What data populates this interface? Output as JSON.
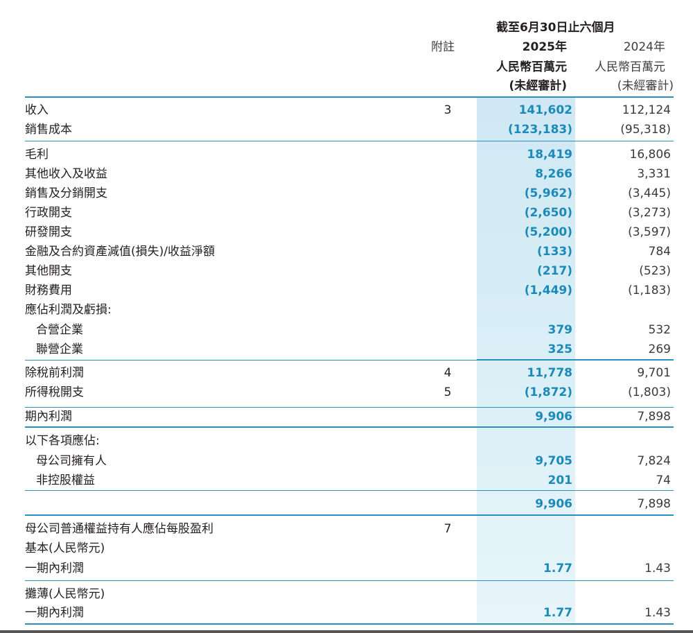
{
  "header": {
    "period": "截至6月30日止六個月",
    "note_label": "附註",
    "year_2025": "2025年",
    "year_2024": "2024年",
    "unit_2025": "人民幣百萬元",
    "unit_2024": "人民幣百萬元",
    "audit_2025": "(未經審計)",
    "audit_2024": "(未經審計)"
  },
  "rows": [
    {
      "label": "收入",
      "note": "3",
      "v2025": "141,602",
      "v2024": "112,124"
    },
    {
      "label": "銷售成本",
      "note": "",
      "v2025": "(123,183)",
      "v2024": "(95,318)"
    },
    {
      "label": "毛利",
      "note": "",
      "v2025": "18,419",
      "v2024": "16,806"
    },
    {
      "label": "其他收入及收益",
      "note": "",
      "v2025": "8,266",
      "v2024": "3,331"
    },
    {
      "label": "銷售及分銷開支",
      "note": "",
      "v2025": "(5,962)",
      "v2024": "(3,445)"
    },
    {
      "label": "行政開支",
      "note": "",
      "v2025": "(2,650)",
      "v2024": "(3,273)"
    },
    {
      "label": "研發開支",
      "note": "",
      "v2025": "(5,200)",
      "v2024": "(3,597)"
    },
    {
      "label": "金融及合約資產減值(損失)/收益淨額",
      "note": "",
      "v2025": "(133)",
      "v2024": "784"
    },
    {
      "label": "其他開支",
      "note": "",
      "v2025": "(217)",
      "v2024": "(523)"
    },
    {
      "label": "財務費用",
      "note": "",
      "v2025": "(1,449)",
      "v2024": "(1,183)"
    },
    {
      "label": "應佔利潤及虧損:",
      "note": "",
      "v2025": "",
      "v2024": ""
    },
    {
      "label": "合營企業",
      "note": "",
      "v2025": "379",
      "v2024": "532"
    },
    {
      "label": "聯營企業",
      "note": "",
      "v2025": "325",
      "v2024": "269"
    },
    {
      "label": "除稅前利潤",
      "note": "4",
      "v2025": "11,778",
      "v2024": "9,701"
    },
    {
      "label": "所得稅開支",
      "note": "5",
      "v2025": "(1,872)",
      "v2024": "(1,803)"
    },
    {
      "label": "期內利潤",
      "note": "",
      "v2025": "9,906",
      "v2024": "7,898"
    },
    {
      "label": "以下各項應佔:",
      "note": "",
      "v2025": "",
      "v2024": ""
    },
    {
      "label": "母公司擁有人",
      "note": "",
      "v2025": "9,705",
      "v2024": "7,824"
    },
    {
      "label": "非控股權益",
      "note": "",
      "v2025": "201",
      "v2024": "74"
    },
    {
      "label": "",
      "note": "",
      "v2025": "9,906",
      "v2024": "7,898"
    },
    {
      "label": "母公司普通權益持有人應佔每股盈利",
      "note": "7",
      "v2025": "",
      "v2024": ""
    },
    {
      "label": "基本(人民幣元)",
      "note": "",
      "v2025": "",
      "v2024": ""
    },
    {
      "label": "一期內利潤",
      "note": "",
      "v2025": "1.77",
      "v2024": "1.43"
    },
    {
      "label": "攤薄(人民幣元)",
      "note": "",
      "v2025": "",
      "v2024": ""
    },
    {
      "label": "一期內利潤",
      "note": "",
      "v2025": "1.77",
      "v2024": "1.43"
    }
  ]
}
